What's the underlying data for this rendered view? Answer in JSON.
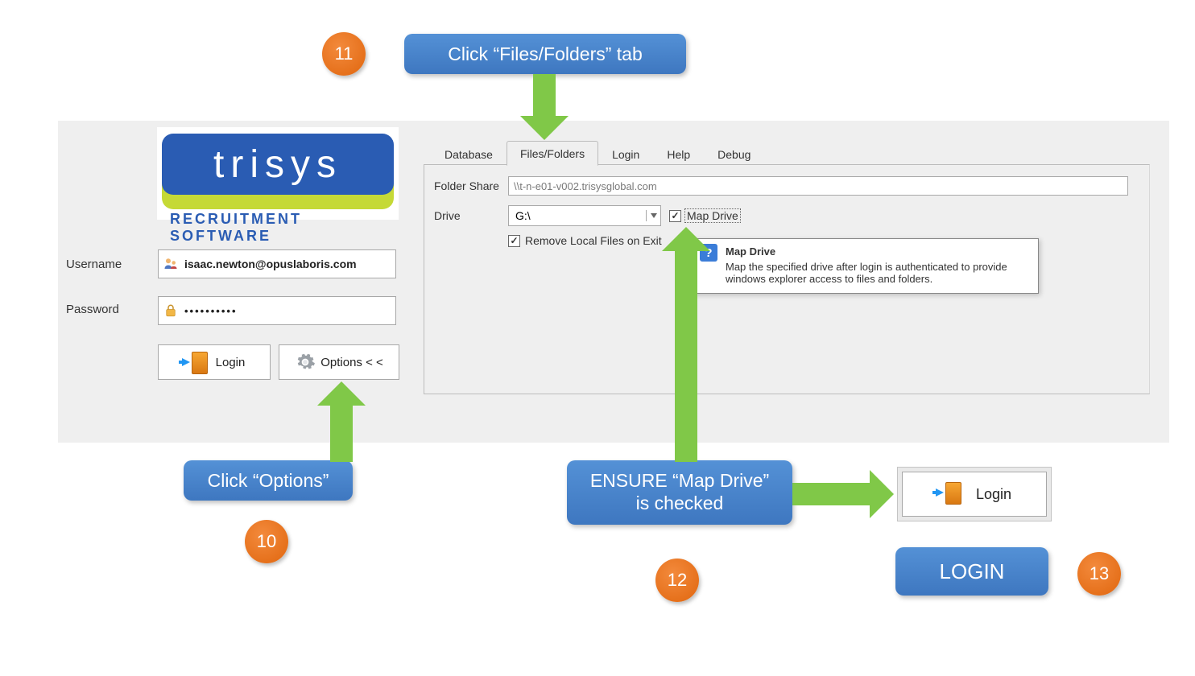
{
  "logo": {
    "brand": "trisys",
    "tagline": "RECRUITMENT SOFTWARE"
  },
  "login": {
    "username_label": "Username",
    "password_label": "Password",
    "username_value": "isaac.newton@opuslaboris.com",
    "password_value": "••••••••••",
    "login_button": "Login",
    "options_button": "Options < <"
  },
  "tabs": {
    "database": "Database",
    "files_folders": "Files/Folders",
    "login": "Login",
    "help": "Help",
    "debug": "Debug"
  },
  "options": {
    "folder_share_label": "Folder Share",
    "folder_share_value": "\\\\t-n-e01-v002.trisysglobal.com",
    "drive_label": "Drive",
    "drive_value": "G:\\",
    "map_drive_label": "Map Drive",
    "remove_local_label": "Remove Local Files on Exit"
  },
  "tooltip": {
    "title": "Map Drive",
    "body": "Map the specified drive after login is authenticated to provide windows explorer access to files and folders."
  },
  "steps": {
    "s10": "10",
    "s11": "11",
    "s12": "12",
    "s13": "13"
  },
  "callouts": {
    "c10": "Click “Options”",
    "c11": "Click “Files/Folders” tab",
    "c12": "ENSURE “Map Drive” is checked",
    "c13": "LOGIN"
  },
  "secondary_login_button": "Login"
}
